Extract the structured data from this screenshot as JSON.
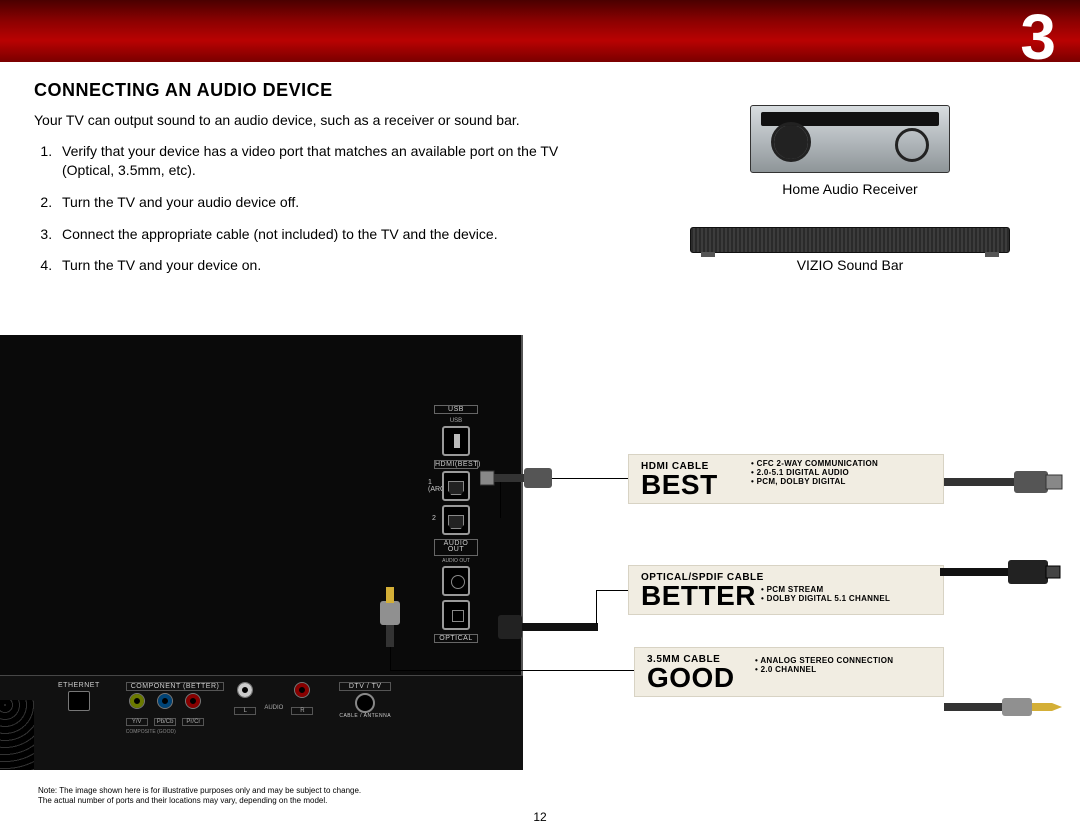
{
  "chapter_number": "3",
  "title": "CONNECTING AN AUDIO DEVICE",
  "intro": "Your TV can output sound to an audio device, such as a receiver or sound bar.",
  "steps": [
    "Verify that your device has a video port that matches an available port on the TV (Optical, 3.5mm, etc).",
    "Turn the TV and your audio device off.",
    "Connect the appropriate cable (not included) to the TV and the device.",
    "Turn the TV and your device on."
  ],
  "devices": {
    "receiver_label": "Home Audio Receiver",
    "soundbar_label": "VIZIO Sound Bar"
  },
  "side_ports": {
    "usb": "USB",
    "hdmi_best": "HDMI(BEST)",
    "hdmi1_sub": "1 (ARC)",
    "hdmi2_sub": "2",
    "audio_out": "AUDIO OUT",
    "audio_out_label": "AUDIO OUT",
    "optical": "OPTICAL"
  },
  "bottom_ports": {
    "ethernet": "ETHERNET",
    "component_header": "COMPONENT (BETTER)",
    "composite_note": "COMPOSITE (GOOD)",
    "yv": "Y/V",
    "pb": "Pb/Cb",
    "pr": "Pr/Cr",
    "l": "L",
    "audio": "AUDIO",
    "r": "R",
    "dtv": "DTV / TV",
    "ant": "CABLE / ANTENNA"
  },
  "quality": {
    "best": {
      "cable": "HDMI CABLE",
      "rank": "BEST",
      "features": [
        "CFC 2-WAY COMMUNICATION",
        "2.0-5.1 DIGITAL AUDIO",
        "PCM, DOLBY DIGITAL"
      ]
    },
    "better": {
      "cable": "OPTICAL/SPDIF CABLE",
      "rank": "BETTER",
      "features": [
        "PCM STREAM",
        "DOLBY DIGITAL 5.1 CHANNEL"
      ]
    },
    "good": {
      "cable": "3.5MM CABLE",
      "rank": "GOOD",
      "features": [
        "ANALOG STEREO CONNECTION",
        "2.0 CHANNEL"
      ]
    }
  },
  "footnote_l1": "Note:  The image shown here is for illustrative purposes only and may be subject to change.",
  "footnote_l2": "The actual number of ports and their locations may vary, depending on the model.",
  "page_number": "12"
}
